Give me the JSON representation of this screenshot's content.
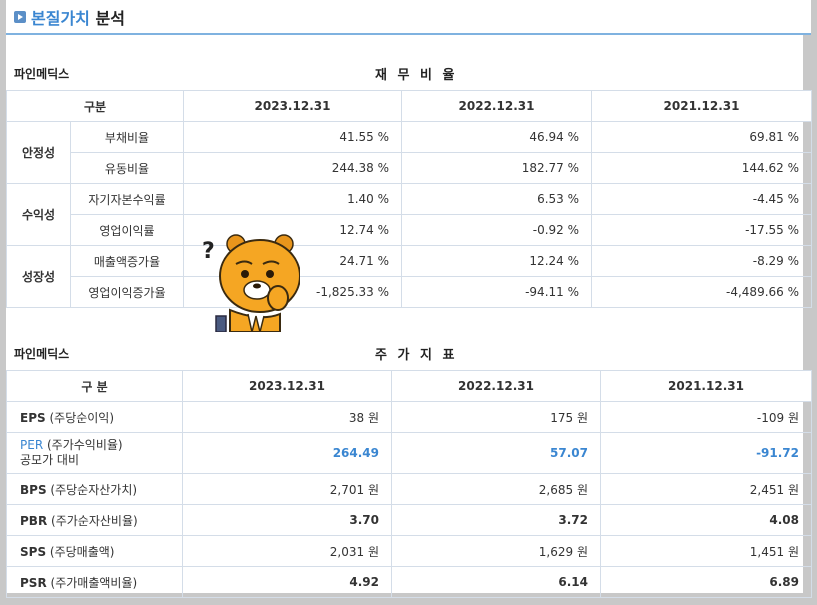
{
  "header": {
    "title_highlight": "본질가치",
    "title_rest": "분석"
  },
  "ratio_section": {
    "company": "파인메딕스",
    "title": "재 무 비 율",
    "col_header": "구분",
    "years": [
      "2023.12.31",
      "2022.12.31",
      "2021.12.31"
    ],
    "groups": [
      {
        "name": "안정성",
        "rows": [
          {
            "label": "부채비율",
            "values": [
              "41.55 %",
              "46.94 %",
              "69.81 %"
            ]
          },
          {
            "label": "유동비율",
            "values": [
              "244.38 %",
              "182.77 %",
              "144.62 %"
            ]
          }
        ]
      },
      {
        "name": "수익성",
        "rows": [
          {
            "label": "자기자본수익률",
            "values": [
              "1.40 %",
              "6.53 %",
              "-4.45 %"
            ]
          },
          {
            "label": "영업이익률",
            "values": [
              "12.74 %",
              "-0.92 %",
              "-17.55 %"
            ]
          }
        ]
      },
      {
        "name": "성장성",
        "rows": [
          {
            "label": "매출액증가율",
            "values": [
              "24.71 %",
              "12.24 %",
              "-8.29 %"
            ]
          },
          {
            "label": "영업이익증가율",
            "values": [
              "-1,825.33 %",
              "-94.11 %",
              "-4,489.66 %"
            ]
          }
        ]
      }
    ]
  },
  "stock_section": {
    "company": "파인메딕스",
    "title": "주 가 지 표",
    "col_header": "구 분",
    "years": [
      "2023.12.31",
      "2022.12.31",
      "2021.12.31"
    ],
    "rows": [
      {
        "code": "EPS",
        "desc": "(주당순이익)",
        "extra": "",
        "values": [
          "38 원",
          "175 원",
          "-109 원"
        ],
        "style": "plain"
      },
      {
        "code": "PER",
        "desc": "(주가수익비율)",
        "extra": "공모가 대비",
        "values": [
          "264.49",
          "57.07",
          "-91.72"
        ],
        "style": "blue"
      },
      {
        "code": "BPS",
        "desc": "(주당순자산가치)",
        "extra": "",
        "values": [
          "2,701 원",
          "2,685 원",
          "2,451 원"
        ],
        "style": "plain"
      },
      {
        "code": "PBR",
        "desc": "(주가순자산비율)",
        "extra": "",
        "values": [
          "3.70",
          "3.72",
          "4.08"
        ],
        "style": "bold"
      },
      {
        "code": "SPS",
        "desc": "(주당매출액)",
        "extra": "",
        "values": [
          "2,031 원",
          "1,629 원",
          "1,451 원"
        ],
        "style": "plain"
      },
      {
        "code": "PSR",
        "desc": "(주가매출액비율)",
        "extra": "",
        "values": [
          "4.92",
          "6.14",
          "6.89"
        ],
        "style": "bold"
      }
    ]
  },
  "mascot": {
    "icon": "thinking-bear-mascot",
    "color": "#f5a623"
  }
}
